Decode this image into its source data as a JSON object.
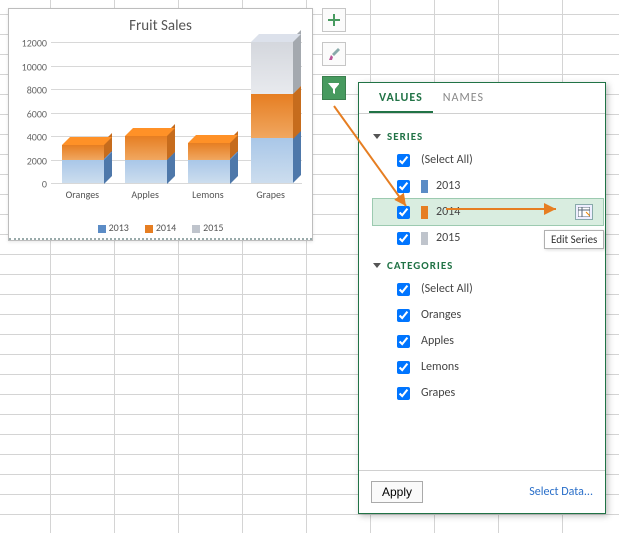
{
  "chart_data": {
    "type": "bar",
    "title": "Fruit Sales",
    "categories": [
      "Oranges",
      "Apples",
      "Lemons",
      "Grapes"
    ],
    "series": [
      {
        "name": "2013",
        "color": "#5B8CC6",
        "values": [
          2000,
          2000,
          2000,
          3800
        ]
      },
      {
        "name": "2014",
        "color": "#E67E22",
        "values": [
          1200,
          2000,
          1400,
          3800
        ]
      },
      {
        "name": "2015",
        "color": "#BFC4CC",
        "values": [
          0,
          0,
          0,
          4400
        ]
      }
    ],
    "ylabel": "",
    "xlabel": "",
    "ylim": [
      0,
      12000
    ],
    "yticks": [
      0,
      2000,
      4000,
      6000,
      8000,
      10000,
      12000
    ],
    "legend_position": "bottom",
    "stacked": true
  },
  "tools": {
    "plus_title": "Chart Elements",
    "brush_title": "Chart Styles",
    "filter_title": "Chart Filters"
  },
  "panel": {
    "tabs": {
      "values": "VALUES",
      "names": "NAMES"
    },
    "series_header": "SERIES",
    "categories_header": "CATEGORIES",
    "select_all": "(Select All)",
    "series_items": [
      "2013",
      "2014",
      "2015"
    ],
    "category_items": [
      "Oranges",
      "Apples",
      "Lemons",
      "Grapes"
    ],
    "highlighted_series_index": 1,
    "apply": "Apply",
    "select_data": "Select Data...",
    "edit_tooltip": "Edit Series"
  }
}
